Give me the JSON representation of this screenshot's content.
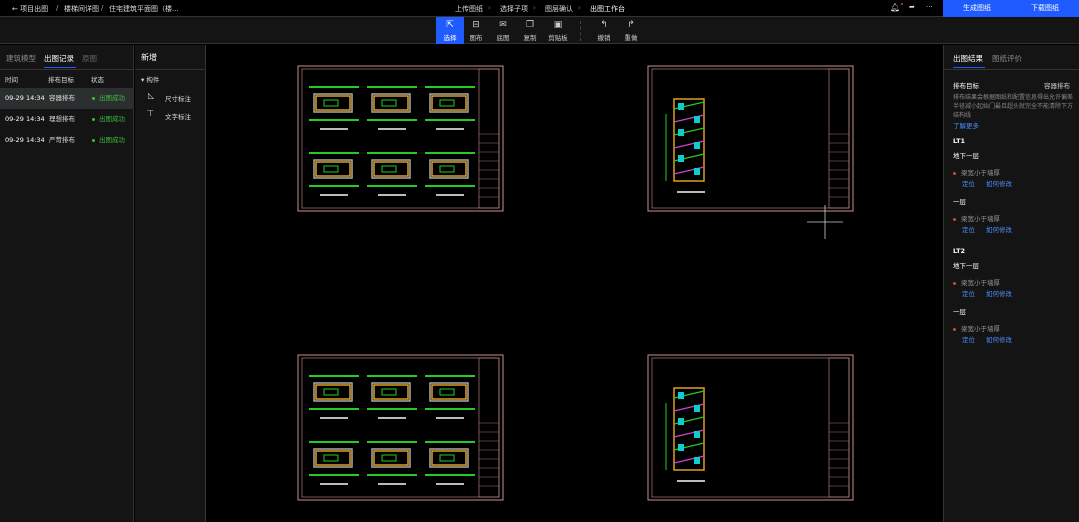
{
  "breadcrumb": {
    "back": "项目出图",
    "items": [
      "楼梯间详图",
      "住宅建筑平面图（楼..."
    ],
    "sep": "/"
  },
  "steps": [
    "上传图纸",
    "选择子项",
    "图层确认",
    "出图工作台"
  ],
  "toolbar": [
    {
      "label": "选择",
      "icon": "cursor-icon",
      "glyph": "⇱"
    },
    {
      "label": "图布",
      "icon": "layout-icon",
      "glyph": "⊟"
    },
    {
      "label": "底图",
      "icon": "image-icon",
      "glyph": "✉"
    },
    {
      "label": "复制",
      "icon": "copy-icon",
      "glyph": "❐"
    },
    {
      "label": "剪贴板",
      "icon": "clipboard-icon",
      "glyph": "▣"
    },
    {
      "label": "撤销",
      "icon": "undo-icon",
      "glyph": "↰"
    },
    {
      "label": "重做",
      "icon": "redo-icon",
      "glyph": "↱"
    }
  ],
  "actions": {
    "generate": "生成图纸",
    "download": "下载图纸",
    "more": "···"
  },
  "left": {
    "tabs": [
      "建筑模型",
      "出图记录",
      "原图"
    ],
    "headers": [
      "时间",
      "排布目标",
      "状态"
    ],
    "rows": [
      {
        "time": "09-29 14:34",
        "target": "容器排布",
        "status": "出图成功"
      },
      {
        "time": "09-29 14:34",
        "target": "理想排布",
        "status": "出图成功"
      },
      {
        "time": "09-29 14:34",
        "target": "严苛排布",
        "status": "出图成功"
      }
    ]
  },
  "mid": {
    "title": "新增",
    "group": "构件",
    "items": [
      "尺寸标注",
      "文字标注"
    ]
  },
  "right": {
    "tabs": [
      "出图结果",
      "图纸评价"
    ],
    "target_label": "排布目标",
    "target_value": "容器排布",
    "desc": "排布结果会根据图纸和配置信息得出允许偏差半径减小起始门最且超头就完全不能清除下方结构线",
    "more": "了解更多",
    "groups": [
      {
        "name": "LT1",
        "floors": [
          {
            "floor": "地下一层",
            "issue": "梁宽小于墙厚"
          },
          {
            "floor": "一层",
            "issue": "梁宽小于墙厚"
          }
        ]
      },
      {
        "name": "LT2",
        "floors": [
          {
            "floor": "地下一层",
            "issue": "梁宽小于墙厚"
          },
          {
            "floor": "一层",
            "issue": "梁宽小于墙厚"
          }
        ]
      }
    ],
    "locate": "定位",
    "howto": "如何修改"
  },
  "colors": {
    "accent": "#1f5bff",
    "success": "#3bbf3b",
    "frame": "#c89090"
  }
}
